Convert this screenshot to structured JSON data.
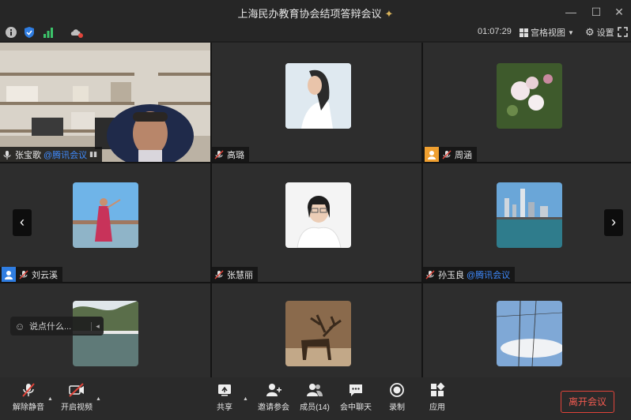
{
  "window": {
    "title": "上海民办教育协会结项答辩会议"
  },
  "infobar": {
    "clock": "01:07:29",
    "view_label": "宫格视图",
    "settings_label": "设置"
  },
  "participants": [
    {
      "name": "张宝歌",
      "org": "@腾讯会议",
      "type": "video"
    },
    {
      "name": "高璐",
      "org": "",
      "type": "avatar"
    },
    {
      "name": "周涵",
      "org": "",
      "type": "avatar"
    },
    {
      "name": "刘云溪",
      "org": "",
      "type": "avatar"
    },
    {
      "name": "张慧丽",
      "org": "",
      "type": "avatar"
    },
    {
      "name": "孙玉良",
      "org": "@腾讯会议",
      "type": "avatar"
    },
    {
      "name": "",
      "org": "",
      "type": "avatar"
    },
    {
      "name": "",
      "org": "",
      "type": "avatar"
    },
    {
      "name": "",
      "org": "",
      "type": "avatar"
    }
  ],
  "chat": {
    "placeholder": "说点什么..."
  },
  "toolbar": {
    "unmute": "解除静音",
    "start_video": "开启视频",
    "share": "共享",
    "invite": "邀请参会",
    "members": "成员(14)",
    "chat": "会中聊天",
    "record": "录制",
    "apps": "应用",
    "leave": "离开会议"
  },
  "colors": {
    "accent_blue": "#3f8bff",
    "leave_red": "#e0443a",
    "host_orange": "#f0a030",
    "cohost_blue": "#2f7de1"
  }
}
